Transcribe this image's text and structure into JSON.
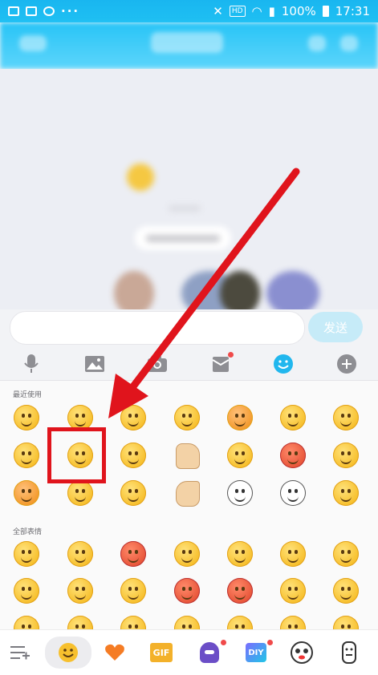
{
  "status_bar": {
    "battery": "100%",
    "time": "17:31",
    "hd": "HD",
    "dots": "···"
  },
  "input": {
    "send_label": "发送",
    "placeholder": ""
  },
  "toolbar": {
    "icons": [
      "microphone-icon",
      "image-icon",
      "camera-icon",
      "red-packet-icon",
      "emoji-icon",
      "plus-icon"
    ]
  },
  "emoji_panel": {
    "recent_title": "最近使用",
    "all_title": "全部表情"
  },
  "bottom_bar": {
    "gif_label": "GIF",
    "diy_label": "DIY"
  },
  "colors": {
    "accent": "#1fc0f3",
    "highlight_box": "#e0141c",
    "arrow": "#e0141c",
    "emoji_yellow": "#f7c02e"
  }
}
